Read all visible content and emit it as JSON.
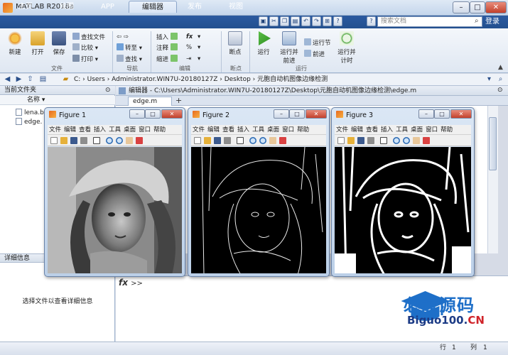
{
  "window": {
    "title": "MATLAB R2018a",
    "min": "–",
    "max": "□",
    "close": "✕"
  },
  "tabs": [
    "主页",
    "绘图",
    "APP",
    "编辑器",
    "发布",
    "视图"
  ],
  "active_tab_index": 3,
  "search": {
    "placeholder": "搜索文档"
  },
  "login": "登录",
  "ribbon": {
    "file": {
      "new": "新建",
      "open": "打开",
      "save": "保存",
      "find_files": "查找文件",
      "compare": "比较",
      "print": "打印",
      "group": "文件"
    },
    "navigate": {
      "goto": "转至",
      "find": "查找",
      "group": "导航"
    },
    "edit": {
      "insert": "插入",
      "comment": "注释",
      "indent": "缩进",
      "group": "编辑"
    },
    "breakpoints": {
      "label": "断点",
      "group": "断点"
    },
    "run": {
      "run": "运行",
      "run_advance_1": "运行并",
      "run_advance_2": "前进",
      "run_section": "运行节",
      "advance": "前进",
      "run_time_1": "运行并",
      "run_time_2": "计时",
      "group": "运行"
    }
  },
  "address": {
    "path": "C:  ›  Users  ›  Administrator.WIN7U-20180127Z  ›  Desktop  ›  元胞自动机图像边缘检测"
  },
  "current_folder": {
    "header": "当前文件夹",
    "col_name": "名称 ▾",
    "files": [
      "lena.b",
      "edge."
    ]
  },
  "details": {
    "header": "详细信息",
    "empty_text": "选择文件以查看详细信息"
  },
  "editor": {
    "header": "编辑器 - C:\\Users\\Administrator.WIN7U-20180127Z\\Desktop\\元胞自动机图像边缘检测\\edge.m",
    "tab": "edge.m",
    "add_tab": "+"
  },
  "command": {
    "fx": "fx",
    "prompt": ">>"
  },
  "status": {
    "row_label": "行",
    "row_value": "1",
    "col_label": "列",
    "col_value": "1"
  },
  "figure_menu": [
    "文件",
    "编辑",
    "查看",
    "插入",
    "工具",
    "桌面",
    "窗口",
    "帮助"
  ],
  "figures": [
    {
      "title": "Figure 1",
      "style": "gray"
    },
    {
      "title": "Figure 2",
      "style": "edges-dark"
    },
    {
      "title": "Figure 3",
      "style": "edges-bold"
    }
  ],
  "watermark": {
    "cn": "必过源码",
    "en_prefix": "Biguo100.",
    "en_suffix": "CN"
  },
  "colors": {
    "ribbon_tab_bar": "#23508f",
    "watermark_blue": "#1e6fc8",
    "watermark_red": "#d0242a"
  }
}
